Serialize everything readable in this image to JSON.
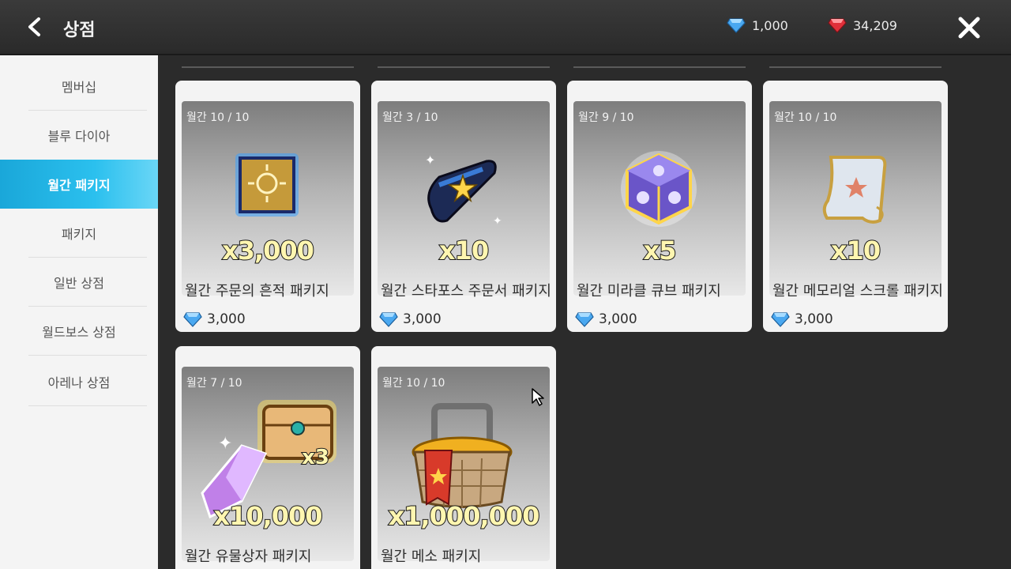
{
  "header": {
    "title": "상점",
    "blue_diamond": "1,000",
    "red_diamond": "34,209"
  },
  "sidebar": {
    "items": [
      {
        "label": "멤버십"
      },
      {
        "label": "블루 다이아"
      },
      {
        "label": "월간 패키지"
      },
      {
        "label": "패키지"
      },
      {
        "label": "일반 상점"
      },
      {
        "label": "월드보스 상점"
      },
      {
        "label": "아레나 상점"
      }
    ],
    "active_index": 2
  },
  "cards": [
    {
      "limit": "월간 10 / 10",
      "qty": "x3,000",
      "name": "월간 주문의 흔적 패키지",
      "price": "3,000",
      "icon": "golden-scroll-icon"
    },
    {
      "limit": "월간 3 / 10",
      "qty": "x10",
      "name": "월간 스타포스 주문서 패키지",
      "price": "3,000",
      "icon": "starforce-scroll-icon"
    },
    {
      "limit": "월간 9 / 10",
      "qty": "x5",
      "name": "월간 미라클 큐브 패키지",
      "price": "3,000",
      "icon": "miracle-cube-icon"
    },
    {
      "limit": "월간 10 / 10",
      "qty": "x10",
      "name": "월간 메모리얼 스크롤 패키지",
      "price": "3,000",
      "icon": "memorial-scroll-icon"
    },
    {
      "limit": "월간 7 / 10",
      "qty": "x10,000",
      "qty2": "x3",
      "name": "월간 유물상자 패키지",
      "price": "",
      "icon": "relic-box-icon"
    },
    {
      "limit": "월간 10 / 10",
      "qty": "x1,000,000",
      "name": "월간 메소 패키지",
      "price": "",
      "icon": "meso-basket-icon"
    }
  ],
  "colors": {
    "accent": "#1aa7d9",
    "blue_diamond": "#4aa8f0",
    "red_diamond": "#e0303a"
  }
}
